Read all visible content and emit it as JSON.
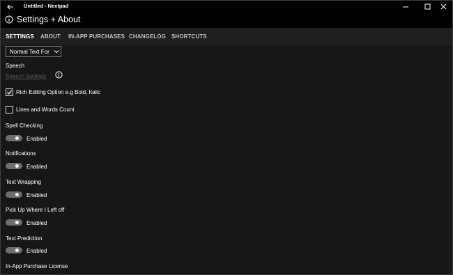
{
  "window": {
    "title": "Untitled - Nextpad",
    "icons": {
      "back": "back-arrow-icon",
      "minimize": "minimize-icon",
      "maximize": "maximize-icon",
      "close": "close-icon"
    }
  },
  "header": {
    "title": "Settings + About",
    "icon": "info-icon"
  },
  "tabs": [
    {
      "label": "SETTINGS",
      "active": true
    },
    {
      "label": "ABOUT",
      "active": false
    },
    {
      "label": "IN-APP PURCHASES",
      "active": false
    },
    {
      "label": "CHANGELOG",
      "active": false
    },
    {
      "label": "SHORTCUTS",
      "active": false
    }
  ],
  "settings": {
    "text_format_dropdown": {
      "value": "Normal Text For"
    },
    "speech": {
      "heading": "Speech",
      "link": "Speech Settings",
      "icon": "info-icon"
    },
    "rich_editing": {
      "label": "Rich Editing Option e.g Bold, Italic",
      "checked": true
    },
    "lines_words_count": {
      "label": "Lines and Words Count",
      "checked": false
    },
    "spell_checking": {
      "heading": "Spell Checking",
      "state": "Enabled",
      "on": true
    },
    "notifications": {
      "heading": "Notifications",
      "state": "Enabled",
      "on": true
    },
    "text_wrapping": {
      "heading": "Text Wrapping",
      "state": "Enabled",
      "on": true
    },
    "pick_up": {
      "heading": "Pick Up Where I Left off",
      "state": "Enabled",
      "on": true
    },
    "text_prediction": {
      "heading": "Text Prediction",
      "state": "Enabled",
      "on": true
    },
    "license": {
      "heading": "In-App Purchase License"
    }
  },
  "colors": {
    "background": "#171717",
    "titlebar": "#000000",
    "tabbar": "#1f1f1f",
    "toggle_track": "#6e6e6e",
    "text": "#ffffff",
    "disabled_text": "#5a5a5a"
  }
}
